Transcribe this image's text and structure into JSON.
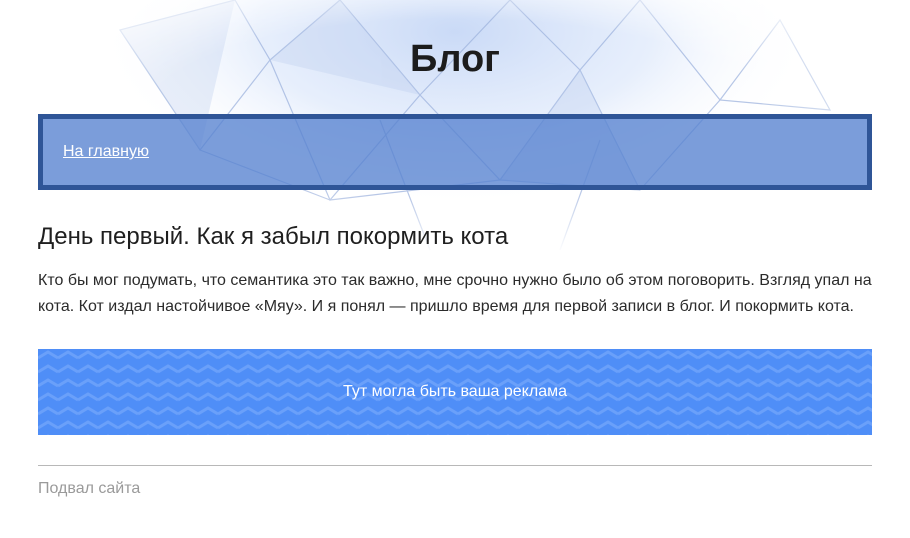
{
  "header": {
    "title": "Блог"
  },
  "nav": {
    "home_link": "На главную"
  },
  "post": {
    "title": "День первый. Как я забыл покормить кота",
    "text": "Кто бы мог подумать, что семантика это так важно, мне срочно нужно было об этом поговорить. Взгляд упал на кота. Кот издал настойчивое «Мяу». И я понял — пришло время для первой записи в блог. И покормить кота."
  },
  "ad": {
    "text": "Тут могла быть ваша реклама"
  },
  "footer": {
    "text": "Подвал сайта"
  },
  "colors": {
    "nav_border": "#2f5597",
    "nav_background": "#5681d0",
    "ad_background": "#4f8ef7",
    "footer_text": "#9a9a9a"
  }
}
